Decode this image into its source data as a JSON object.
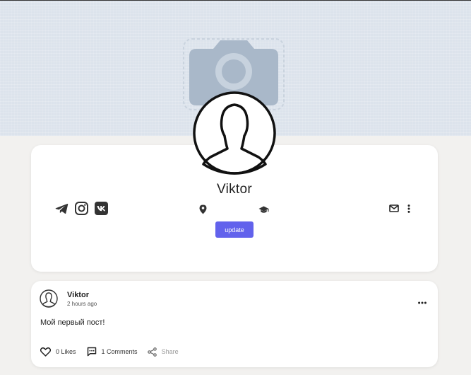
{
  "profile": {
    "name": "Viktor",
    "update_label": "update",
    "social_icons": [
      "telegram-icon",
      "instagram-icon",
      "vk-icon"
    ],
    "info_icons": [
      "location-icon",
      "education-icon"
    ],
    "action_icons": [
      "mail-icon",
      "more-vertical-icon"
    ]
  },
  "post": {
    "author": "Viktor",
    "time": "2 hours ago",
    "text": "Мой первый пост!",
    "likes_label": "0 Likes",
    "comments_label": "1 Comments",
    "share_label": "Share"
  },
  "colors": {
    "page_bg": "#f2f1ef",
    "cover_bg": "#dce3ec",
    "cover_icon": "#a9b8c9",
    "accent": "#6262ec",
    "card_bg": "#ffffff"
  }
}
